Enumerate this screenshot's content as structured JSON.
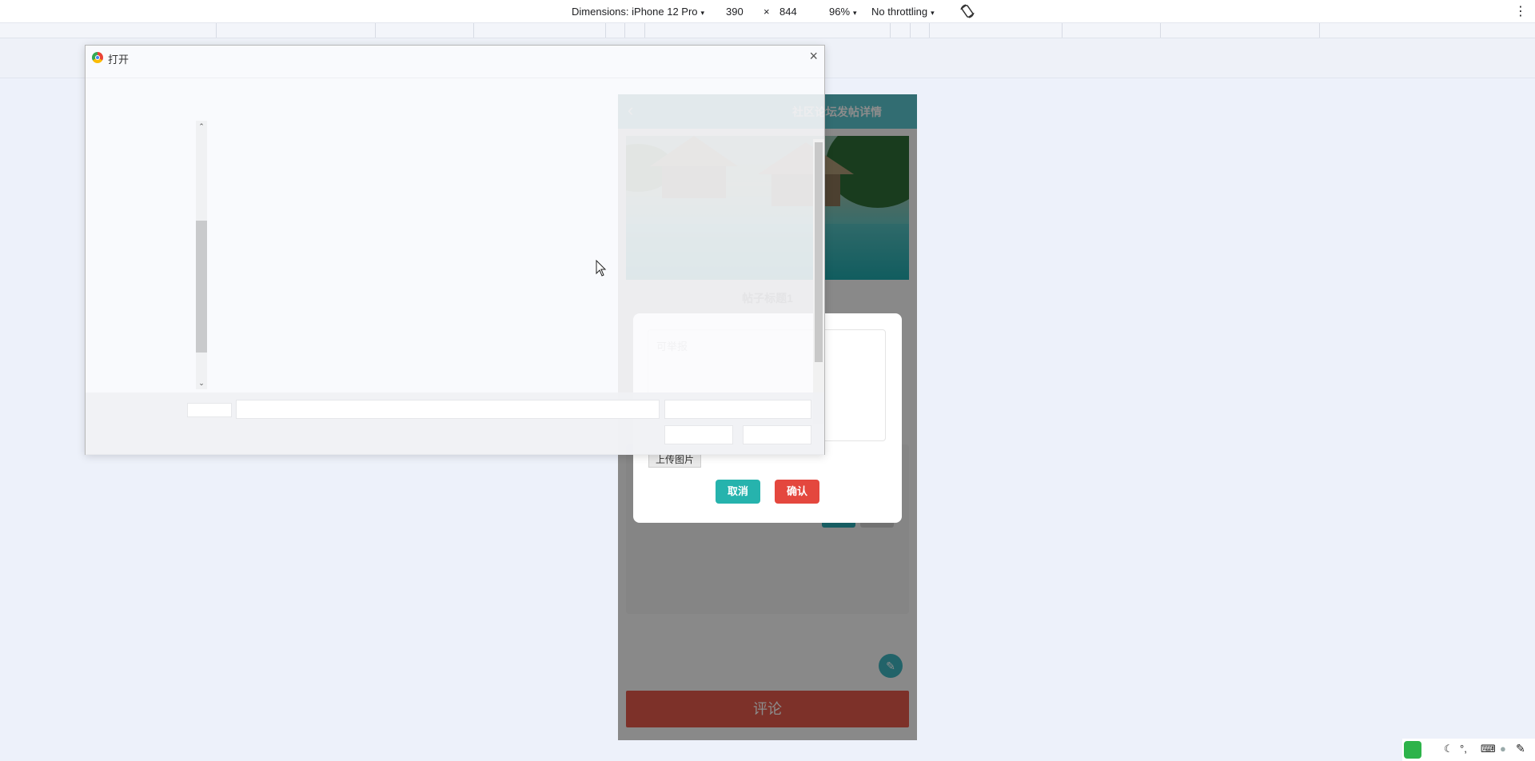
{
  "devtools": {
    "dimensions_label": "Dimensions: iPhone 12 Pro",
    "width": "390",
    "times": "×",
    "height": "844",
    "zoom": "96%",
    "throttling": "No throttling",
    "caret": "▾",
    "rotate_icon": "rotate-icon",
    "more_icon": "⋮"
  },
  "dialog": {
    "title": "打开",
    "close": "×",
    "scroll_up": "⌃",
    "scroll_down": "⌄"
  },
  "page": {
    "back": "‹",
    "title": "社区论坛发帖详情",
    "post_title": "帖子标题1",
    "comment_button": "评论",
    "edit_icon": "✎"
  },
  "modal": {
    "textarea_placeholder": "可举报",
    "upload_label": "上传图片",
    "cancel_label": "取消",
    "confirm_label": "确认"
  },
  "colors": {
    "header": "#5cc6cf",
    "cancel": "#26b3ad",
    "confirm": "#e4473e",
    "comment": "#e45a4b"
  }
}
